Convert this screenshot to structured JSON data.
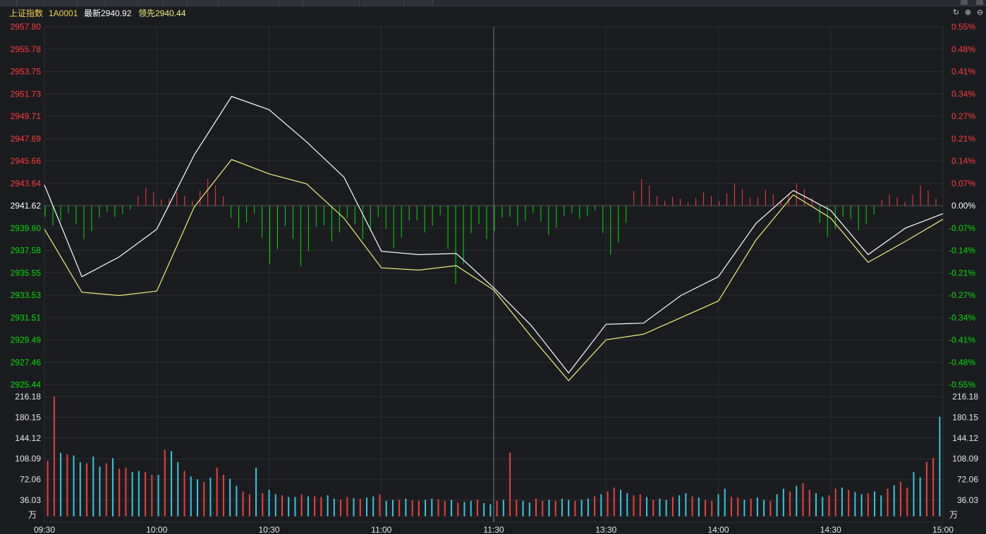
{
  "header": {
    "index_name": "上证指数",
    "code": "1A0001",
    "latest_label": "最新2940.92",
    "leading_label": "领先2940.44"
  },
  "header_icons": [
    {
      "name": "refresh-icon",
      "glyph": "↻"
    },
    {
      "name": "zoom-in-icon",
      "glyph": "⊕"
    },
    {
      "name": "zoom-out-icon",
      "glyph": "⊖"
    }
  ],
  "colors": {
    "background": "#1b1c20",
    "grid": "#2c2d33",
    "up": "#ff3b3b",
    "down": "#00e000",
    "neutral": "#ffffff",
    "price_line": "#ffffff",
    "leading_line": "#f0f07a",
    "volume_cyan": "#36c6e0",
    "volume_red": "#e8413d",
    "header_name": "#f0d34a",
    "header_code": "#f0d34a",
    "header_latest": "#ffffff",
    "header_leading": "#f0f07a"
  },
  "chart_data": [
    {
      "type": "line",
      "title": "上证指数 1A0001",
      "x": [
        "09:30",
        "09:40",
        "09:50",
        "10:00",
        "10:10",
        "10:20",
        "10:30",
        "10:40",
        "10:50",
        "11:00",
        "11:10",
        "11:20",
        "11:30",
        "13:10",
        "13:20",
        "13:30",
        "13:40",
        "13:50",
        "14:00",
        "14:10",
        "14:20",
        "14:30",
        "14:40",
        "14:50",
        "15:00"
      ],
      "x_ticks": [
        "09:30",
        "10:00",
        "10:30",
        "11:00",
        "11:30",
        "13:30",
        "14:00",
        "14:30",
        "15:00"
      ],
      "y_ticks_left": [
        "2957.80",
        "2955.78",
        "2953.75",
        "2951.73",
        "2949.71",
        "2947.69",
        "2945.66",
        "2943.64",
        "2941.62",
        "2939.60",
        "2937.58",
        "2935.55",
        "2933.53",
        "2931.51",
        "2929.49",
        "2927.46",
        "2925.44"
      ],
      "y_ticks_right": [
        "0.55%",
        "0.48%",
        "0.41%",
        "0.34%",
        "0.27%",
        "0.21%",
        "0.14%",
        "0.07%",
        "0.00%",
        "-0.07%",
        "-0.14%",
        "-0.21%",
        "-0.27%",
        "-0.34%",
        "-0.41%",
        "-0.48%",
        "-0.55%"
      ],
      "ylim": [
        2925.44,
        2957.8
      ],
      "reference": 2941.62,
      "series": [
        {
          "name": "最新",
          "values": [
            2943.5,
            2935.2,
            2937.0,
            2939.5,
            2946.2,
            2951.5,
            2950.3,
            2947.4,
            2944.2,
            2937.5,
            2937.2,
            2937.3,
            2934.2,
            2930.8,
            2926.5,
            2930.9,
            2931.0,
            2933.5,
            2935.2,
            2940.0,
            2943.0,
            2941.2,
            2937.2,
            2939.6,
            2940.9
          ]
        },
        {
          "name": "领先",
          "values": [
            2939.5,
            2933.8,
            2933.5,
            2933.9,
            2941.5,
            2945.8,
            2944.5,
            2943.6,
            2940.5,
            2936.0,
            2935.8,
            2936.2,
            2934.0,
            2929.8,
            2925.8,
            2929.5,
            2930.0,
            2931.5,
            2933.0,
            2938.5,
            2942.6,
            2940.5,
            2936.5,
            2938.4,
            2940.4
          ]
        }
      ],
      "bars_label": "",
      "bars_values": [
        -0.9,
        -1.5,
        -0.5,
        0.8,
        0.6,
        1.2,
        -1.0,
        -2.6,
        -2.7,
        -1.6,
        -1.5,
        -1.9,
        -1.2,
        -3.5,
        -1.5,
        -0.9,
        -1.3,
        -0.6,
        -2.2,
        1.2,
        0.4,
        0.6,
        1.0,
        0.7,
        1.0,
        -1.4,
        -1.1,
        0.5,
        0.9
      ]
    },
    {
      "type": "bar",
      "title": "",
      "ylabel": "万",
      "y_ticks": [
        "216.18",
        "180.15",
        "144.12",
        "108.09",
        "72.06",
        "36.03"
      ],
      "ylim": [
        0,
        216.18
      ],
      "values": [
        100,
        216,
        115,
        112,
        110,
        98,
        96,
        108,
        90,
        96,
        105,
        86,
        88,
        80,
        82,
        80,
        75,
        75,
        120,
        118,
        98,
        82,
        72,
        67,
        62,
        70,
        88,
        75,
        68,
        55,
        45,
        40,
        88,
        42,
        48,
        40,
        38,
        35,
        35,
        40,
        36,
        36,
        35,
        38,
        32,
        30,
        35,
        33,
        32,
        34,
        36,
        40,
        28,
        30,
        30,
        32,
        29,
        28,
        30,
        32,
        31,
        28,
        30,
        25,
        26,
        28,
        30,
        24,
        22,
        28,
        30,
        115,
        30,
        28,
        25,
        32,
        28,
        30,
        28,
        32,
        30,
        28,
        30,
        32,
        36,
        40,
        45,
        52,
        48,
        42,
        38,
        40,
        35,
        30,
        32,
        30,
        35,
        38,
        42,
        36,
        34,
        30,
        28,
        40,
        50,
        35,
        34,
        30,
        32,
        34,
        30,
        28,
        40,
        50,
        45,
        55,
        60,
        48,
        42,
        35,
        38,
        50,
        52,
        48,
        44,
        40,
        42,
        45,
        38,
        50,
        56,
        62,
        52,
        80,
        70,
        98,
        105,
        180
      ]
    }
  ]
}
